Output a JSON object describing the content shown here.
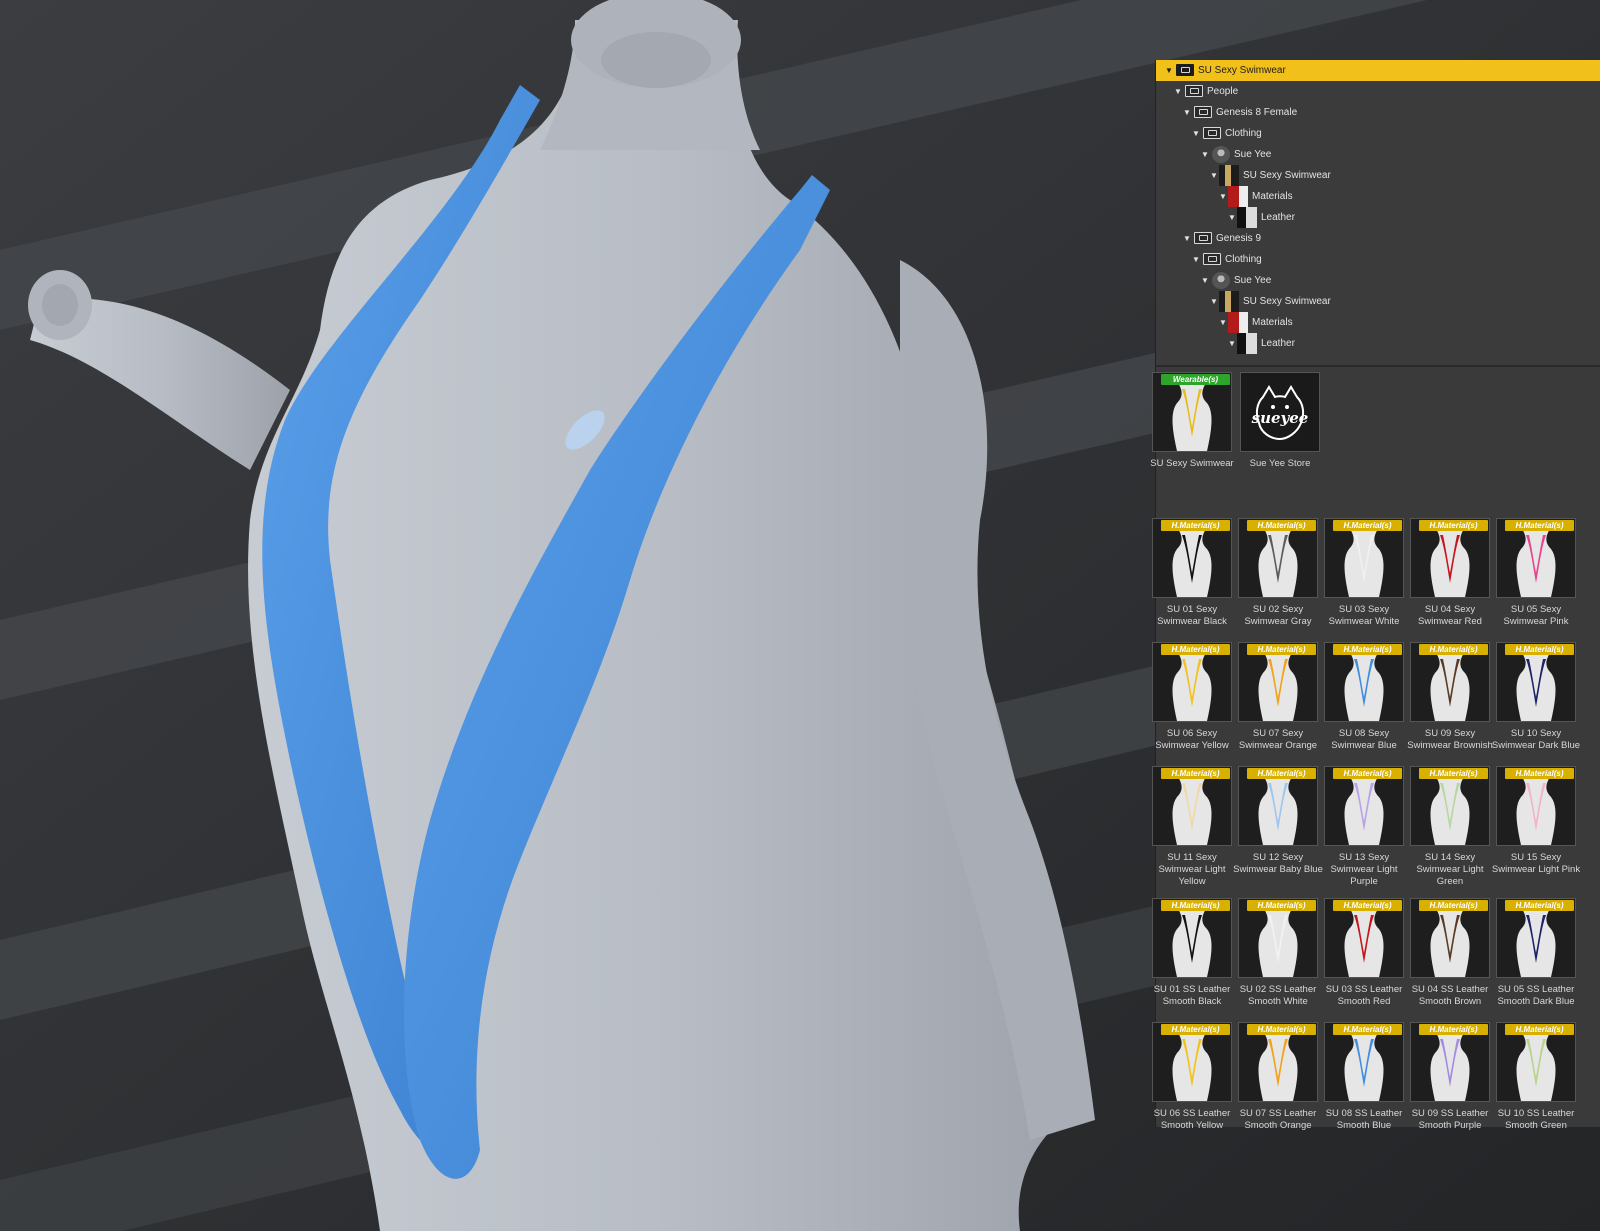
{
  "colors": {
    "accent": "#f2c01a",
    "swimwear_blue": "#4a8fdc",
    "mannequin": "#b7bcc4",
    "panel_bg": "#3a3a3a",
    "wearable_badge": "#2da52b",
    "material_badge": "#d8b100"
  },
  "tree": [
    {
      "label": "SU Sexy Swimwear",
      "depth": 0,
      "icon": "folder-icon",
      "selected": true
    },
    {
      "label": "People",
      "depth": 1,
      "icon": "folder-icon"
    },
    {
      "label": "Genesis 8 Female",
      "depth": 2,
      "icon": "folder-icon"
    },
    {
      "label": "Clothing",
      "depth": 3,
      "icon": "folder-icon"
    },
    {
      "label": "Sue Yee",
      "depth": 4,
      "icon": "vendor-icon"
    },
    {
      "label": "SU Sexy Swimwear",
      "depth": 5,
      "icon": "product-thumb-icon"
    },
    {
      "label": "Materials",
      "depth": 6,
      "icon": "materials-thumb-icon"
    },
    {
      "label": "Leather",
      "depth": 7,
      "icon": "leather-thumb-icon"
    },
    {
      "label": "Genesis 9",
      "depth": 2,
      "icon": "folder-icon"
    },
    {
      "label": "Clothing",
      "depth": 3,
      "icon": "folder-icon"
    },
    {
      "label": "Sue Yee",
      "depth": 4,
      "icon": "vendor-icon"
    },
    {
      "label": "SU Sexy Swimwear",
      "depth": 5,
      "icon": "product-thumb-icon"
    },
    {
      "label": "Materials",
      "depth": 6,
      "icon": "materials-thumb-icon"
    },
    {
      "label": "Leather",
      "depth": 7,
      "icon": "leather-thumb-icon"
    }
  ],
  "top_tiles": [
    {
      "label": "SU Sexy Swimwear",
      "badge": "Wearable(s)",
      "color": "#e8bc1f"
    },
    {
      "label": "Sue Yee Store",
      "badge": "",
      "logo_text": "sueyee"
    }
  ],
  "badge_material": "H.Material(s)",
  "material_tiles": [
    {
      "label": "SU 01 Sexy Swimwear Black",
      "color": "#111111"
    },
    {
      "label": "SU 02 Sexy Swimwear Gray",
      "color": "#5b5b5b"
    },
    {
      "label": "SU 03 Sexy Swimwear White",
      "color": "#f0f0f0"
    },
    {
      "label": "SU 04 Sexy Swimwear Red",
      "color": "#c4161c"
    },
    {
      "label": "SU 05 Sexy Swimwear Pink",
      "color": "#e8418f"
    },
    {
      "label": "SU 06 Sexy Swimwear Yellow",
      "color": "#f3c21a"
    },
    {
      "label": "SU 07 Sexy Swimwear Orange",
      "color": "#f2a21a"
    },
    {
      "label": "SU 08 Sexy Swimwear Blue",
      "color": "#3f8de0"
    },
    {
      "label": "SU 09 Sexy Swimwear Brownish",
      "color": "#5a3a22"
    },
    {
      "label": "SU 10 Sexy Swimwear Dark Blue",
      "color": "#1a2466"
    },
    {
      "label": "SU 11 Sexy Swimwear Light Yellow",
      "color": "#efd9a4"
    },
    {
      "label": "SU 12 Sexy Swimwear Baby Blue",
      "color": "#9cc7ef"
    },
    {
      "label": "SU 13 Sexy Swimwear Light Purple",
      "color": "#b9a3e6"
    },
    {
      "label": "SU 14 Sexy Swimwear Light Green",
      "color": "#b6d8a0"
    },
    {
      "label": "SU 15 Sexy Swimwear Light Pink",
      "color": "#f2b3c9"
    }
  ],
  "leather_tiles": [
    {
      "label": "SU 01 SS Leather Smooth Black",
      "color": "#121212"
    },
    {
      "label": "SU 02 SS Leather Smooth White",
      "color": "#f2f2f2"
    },
    {
      "label": "SU 03 SS Leather Smooth Red",
      "color": "#c5161c"
    },
    {
      "label": "SU 04 SS Leather Smooth Brown",
      "color": "#5a3a22"
    },
    {
      "label": "SU 05 SS Leather Smooth Dark Blue",
      "color": "#1a2466"
    },
    {
      "label": "SU 06 SS Leather Smooth Yellow",
      "color": "#f2c21a"
    },
    {
      "label": "SU 07 SS Leather Smooth Orange",
      "color": "#f2a21a"
    },
    {
      "label": "SU 08 SS Leather Smooth Blue",
      "color": "#3f8de0"
    },
    {
      "label": "SU 09 SS Leather Smooth Purple",
      "color": "#a48ae0"
    },
    {
      "label": "SU 10 SS Leather Smooth Green",
      "color": "#b7d48c"
    }
  ]
}
